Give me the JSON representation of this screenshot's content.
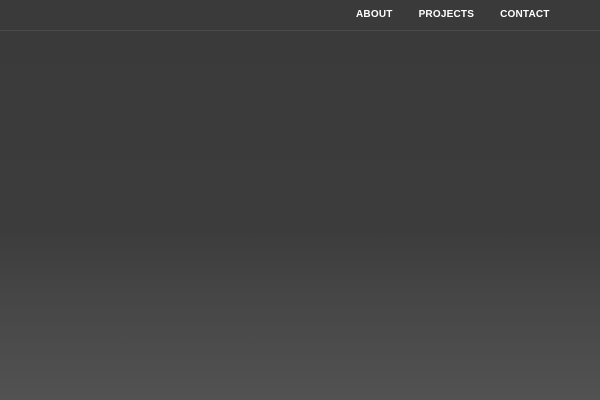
{
  "nav": {
    "items": [
      {
        "label": "ABOUT"
      },
      {
        "label": "PROJECTS"
      },
      {
        "label": "CONTACT"
      }
    ]
  }
}
